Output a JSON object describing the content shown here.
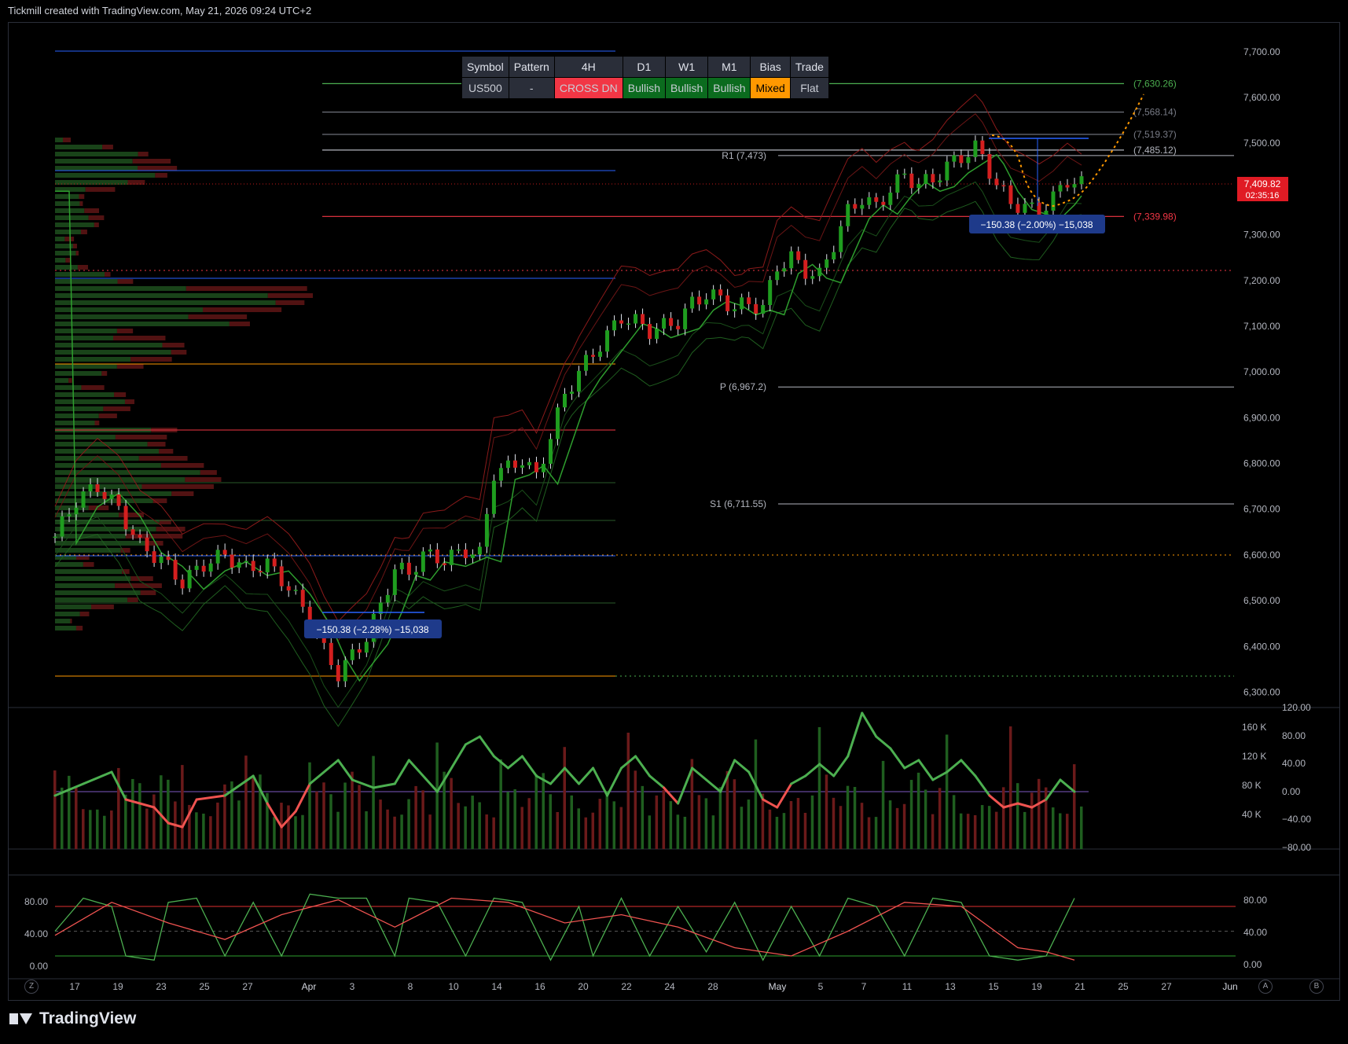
{
  "header": {
    "caption": "Tickmill created with TradingView.com, May 21, 2026 09:24 UTC+2"
  },
  "brand": {
    "name": "TradingView"
  },
  "table": {
    "headers": [
      "Symbol",
      "Pattern",
      "4H",
      "D1",
      "W1",
      "M1",
      "Bias",
      "Trade"
    ],
    "values": [
      "US500",
      "-",
      "CROSS DN",
      "Bullish",
      "Bullish",
      "Bullish",
      "Mixed",
      "Flat"
    ],
    "colors": [
      "#2a2e39",
      "#2a2e39",
      "#f23645",
      "#0b6b1e",
      "#0b6b1e",
      "#0b6b1e",
      "#ff9800",
      "#2a2e39"
    ]
  },
  "colors": {
    "bull": "#1b7a1b",
    "bear": "#c21a1a",
    "white": "#e0e3eb",
    "grid": "#1e222d",
    "accent_orange": "#ff9800",
    "blue": "#2962ff",
    "label_blue": "#1e3a8a"
  },
  "chart_data": [
    {
      "type": "candlestick",
      "symbol": "US500",
      "x_tick_labels": [
        "17",
        "19",
        "23",
        "25",
        "27",
        "Apr",
        "3",
        "8",
        "10",
        "14",
        "16",
        "20",
        "22",
        "24",
        "28",
        "May",
        "5",
        "7",
        "11",
        "13",
        "15",
        "19",
        "21",
        "25",
        "27",
        "Jun"
      ],
      "y_ticks": [
        "7,700.00",
        "7,600.00",
        "7,500.00",
        "7,400.00",
        "7,300.00",
        "7,200.00",
        "7,100.00",
        "7,000.00",
        "6,900.00",
        "6,800.00",
        "6,700.00",
        "6,600.00",
        "6,500.00",
        "6,400.00",
        "6,300.00"
      ],
      "ylim": [
        6275,
        7710
      ],
      "close_path": [
        [
          0,
          6640
        ],
        [
          3,
          6720
        ],
        [
          6,
          6750
        ],
        [
          9,
          6700
        ],
        [
          12,
          6620
        ],
        [
          15,
          6590
        ],
        [
          18,
          6540
        ],
        [
          21,
          6580
        ],
        [
          24,
          6600
        ],
        [
          27,
          6570
        ],
        [
          30,
          6580
        ],
        [
          33,
          6530
        ],
        [
          36,
          6460
        ],
        [
          38,
          6390
        ],
        [
          40,
          6340
        ],
        [
          42,
          6380
        ],
        [
          44,
          6420
        ],
        [
          46,
          6490
        ],
        [
          48,
          6570
        ],
        [
          50,
          6560
        ],
        [
          52,
          6600
        ],
        [
          55,
          6590
        ],
        [
          58,
          6610
        ],
        [
          60,
          6600
        ],
        [
          62,
          6780
        ],
        [
          64,
          6790
        ],
        [
          66,
          6810
        ],
        [
          68,
          6770
        ],
        [
          70,
          6860
        ],
        [
          72,
          6950
        ],
        [
          74,
          7000
        ],
        [
          76,
          7040
        ],
        [
          78,
          7080
        ],
        [
          80,
          7120
        ],
        [
          82,
          7110
        ],
        [
          84,
          7090
        ],
        [
          86,
          7100
        ],
        [
          88,
          7110
        ],
        [
          90,
          7150
        ],
        [
          92,
          7170
        ],
        [
          94,
          7160
        ],
        [
          96,
          7140
        ],
        [
          98,
          7150
        ],
        [
          100,
          7140
        ],
        [
          102,
          7230
        ],
        [
          104,
          7250
        ],
        [
          106,
          7220
        ],
        [
          108,
          7210
        ],
        [
          110,
          7280
        ],
        [
          112,
          7350
        ],
        [
          114,
          7380
        ],
        [
          116,
          7360
        ],
        [
          118,
          7400
        ],
        [
          120,
          7430
        ],
        [
          122,
          7410
        ],
        [
          124,
          7420
        ],
        [
          126,
          7450
        ],
        [
          128,
          7470
        ],
        [
          130,
          7490
        ],
        [
          131,
          7470
        ],
        [
          133,
          7410
        ],
        [
          135,
          7370
        ],
        [
          137,
          7360
        ],
        [
          139,
          7350
        ],
        [
          141,
          7380
        ],
        [
          143,
          7420
        ],
        [
          145,
          7410
        ]
      ],
      "levels": [
        {
          "label": "(7,630.26)",
          "value": 7630.26,
          "color": "#4caf50"
        },
        {
          "label": "(7,568.14)",
          "value": 7568.14,
          "color": "#787b86"
        },
        {
          "label": "(7,519.37)",
          "value": 7519.37,
          "color": "#787b86"
        },
        {
          "label": "(7,485.12)",
          "value": 7485.12,
          "color": "#b2b5be"
        },
        {
          "label": "(7,339.98)",
          "value": 7339.98,
          "color": "#f23645"
        }
      ],
      "pivots": [
        {
          "label": "R1 (7,473)",
          "value": 7473
        },
        {
          "label": "P (6,967.2)",
          "value": 6967.2
        },
        {
          "label": "S1 (6,711.55)",
          "value": 6711.55
        }
      ],
      "last_price": {
        "value_label": "7,409.82",
        "countdown": "02:35:16",
        "value": 7409.82
      },
      "measure_labels": [
        "−150.38 (−2.28%) −15,038",
        "−150.38 (−2.00%) −15,038"
      ]
    },
    {
      "type": "bar+line",
      "name": "volume-oscillator",
      "left_axis": [
        "160 K",
        "120 K",
        "80 K",
        "40 K"
      ],
      "right_axis": [
        "120.00",
        "80.00",
        "40.00",
        "0.00",
        "−40.00",
        "−80.00"
      ],
      "line_path": [
        [
          0,
          -5
        ],
        [
          4,
          10
        ],
        [
          8,
          25
        ],
        [
          10,
          -10
        ],
        [
          14,
          -20
        ],
        [
          16,
          -40
        ],
        [
          18,
          -45
        ],
        [
          20,
          -10
        ],
        [
          24,
          -5
        ],
        [
          28,
          20
        ],
        [
          30,
          -15
        ],
        [
          32,
          -45
        ],
        [
          34,
          -25
        ],
        [
          36,
          10
        ],
        [
          40,
          40
        ],
        [
          42,
          15
        ],
        [
          45,
          5
        ],
        [
          48,
          10
        ],
        [
          50,
          40
        ],
        [
          54,
          0
        ],
        [
          58,
          60
        ],
        [
          60,
          70
        ],
        [
          62,
          45
        ],
        [
          64,
          30
        ],
        [
          66,
          45
        ],
        [
          68,
          20
        ],
        [
          70,
          10
        ],
        [
          72,
          30
        ],
        [
          74,
          10
        ],
        [
          76,
          30
        ],
        [
          78,
          -5
        ],
        [
          80,
          30
        ],
        [
          82,
          45
        ],
        [
          84,
          20
        ],
        [
          86,
          5
        ],
        [
          88,
          -15
        ],
        [
          90,
          30
        ],
        [
          92,
          15
        ],
        [
          94,
          0
        ],
        [
          96,
          40
        ],
        [
          98,
          25
        ],
        [
          100,
          -10
        ],
        [
          102,
          -20
        ],
        [
          104,
          10
        ],
        [
          106,
          20
        ],
        [
          108,
          35
        ],
        [
          110,
          20
        ],
        [
          112,
          45
        ],
        [
          114,
          100
        ],
        [
          116,
          70
        ],
        [
          118,
          55
        ],
        [
          120,
          30
        ],
        [
          122,
          40
        ],
        [
          124,
          15
        ],
        [
          126,
          25
        ],
        [
          128,
          40
        ],
        [
          130,
          20
        ],
        [
          132,
          -5
        ],
        [
          134,
          -20
        ],
        [
          136,
          -15
        ],
        [
          138,
          -20
        ],
        [
          140,
          -10
        ],
        [
          142,
          15
        ],
        [
          144,
          0
        ]
      ]
    },
    {
      "type": "line",
      "name": "stochastic",
      "y_ticks_left": [
        "80.00",
        "40.00",
        "0.00"
      ],
      "y_ticks_right": [
        "80.00",
        "40.00",
        "0.00"
      ],
      "k_path": [
        [
          0,
          50
        ],
        [
          4,
          90
        ],
        [
          8,
          80
        ],
        [
          10,
          20
        ],
        [
          14,
          15
        ],
        [
          16,
          85
        ],
        [
          20,
          90
        ],
        [
          24,
          20
        ],
        [
          28,
          85
        ],
        [
          32,
          20
        ],
        [
          36,
          95
        ],
        [
          40,
          90
        ],
        [
          44,
          90
        ],
        [
          48,
          20
        ],
        [
          50,
          90
        ],
        [
          54,
          85
        ],
        [
          58,
          20
        ],
        [
          62,
          90
        ],
        [
          66,
          85
        ],
        [
          70,
          15
        ],
        [
          74,
          80
        ],
        [
          76,
          20
        ],
        [
          80,
          90
        ],
        [
          84,
          20
        ],
        [
          88,
          80
        ],
        [
          92,
          25
        ],
        [
          96,
          85
        ],
        [
          100,
          15
        ],
        [
          104,
          80
        ],
        [
          108,
          20
        ],
        [
          112,
          90
        ],
        [
          116,
          80
        ],
        [
          120,
          20
        ],
        [
          124,
          90
        ],
        [
          128,
          85
        ],
        [
          132,
          20
        ],
        [
          136,
          15
        ],
        [
          140,
          20
        ],
        [
          144,
          90
        ]
      ],
      "d_path": [
        [
          0,
          45
        ],
        [
          8,
          85
        ],
        [
          16,
          60
        ],
        [
          24,
          40
        ],
        [
          32,
          70
        ],
        [
          40,
          88
        ],
        [
          48,
          55
        ],
        [
          56,
          90
        ],
        [
          64,
          85
        ],
        [
          72,
          60
        ],
        [
          80,
          70
        ],
        [
          88,
          55
        ],
        [
          96,
          30
        ],
        [
          104,
          20
        ],
        [
          112,
          50
        ],
        [
          120,
          85
        ],
        [
          128,
          80
        ],
        [
          136,
          30
        ],
        [
          140,
          25
        ],
        [
          144,
          15
        ]
      ]
    }
  ]
}
